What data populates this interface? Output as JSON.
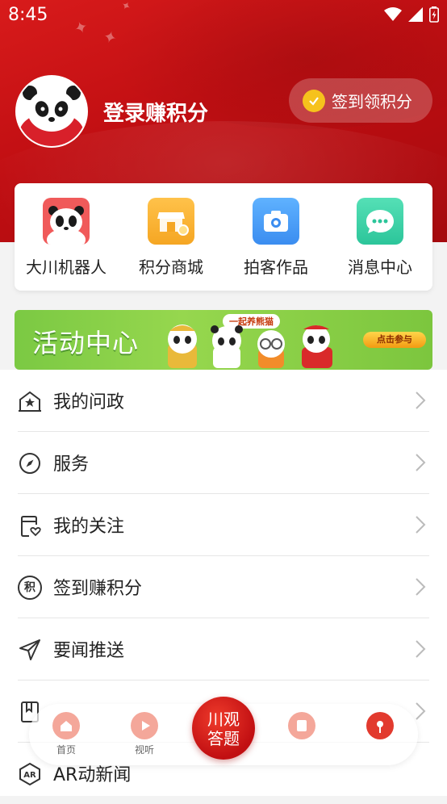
{
  "status_bar": {
    "time": "8:45"
  },
  "profile": {
    "login_text": "登录赚积分",
    "sign_button": "签到领积分"
  },
  "quick_actions": [
    {
      "label": "大川机器人",
      "icon": "panda-robot-icon"
    },
    {
      "label": "积分商城",
      "icon": "shop-icon"
    },
    {
      "label": "拍客作品",
      "icon": "camera-icon"
    },
    {
      "label": "消息中心",
      "icon": "chat-icon"
    }
  ],
  "banner": {
    "title": "活动中心",
    "bubble": "一起养熊猫",
    "cta": "点击参与"
  },
  "menu": [
    {
      "label": "我的问政",
      "icon": "gov-house-icon"
    },
    {
      "label": "服务",
      "icon": "compass-icon"
    },
    {
      "label": "我的关注",
      "icon": "follow-heart-icon"
    },
    {
      "label": "签到赚积分",
      "icon": "points-icon"
    },
    {
      "label": "要闻推送",
      "icon": "send-icon"
    },
    {
      "label": "",
      "icon": "bookmark-icon"
    },
    {
      "label": "AR动新闻",
      "icon": "ar-icon"
    }
  ],
  "ar_icon_text": "AR",
  "points_icon_text": "积",
  "bottom_nav": {
    "home": "首页",
    "video": "视听",
    "center_line1": "川观",
    "center_line2": "答题"
  },
  "colors": {
    "brand_red": "#c8131a",
    "gold": "#f6c21c",
    "banner_green": "#8fd34b"
  }
}
